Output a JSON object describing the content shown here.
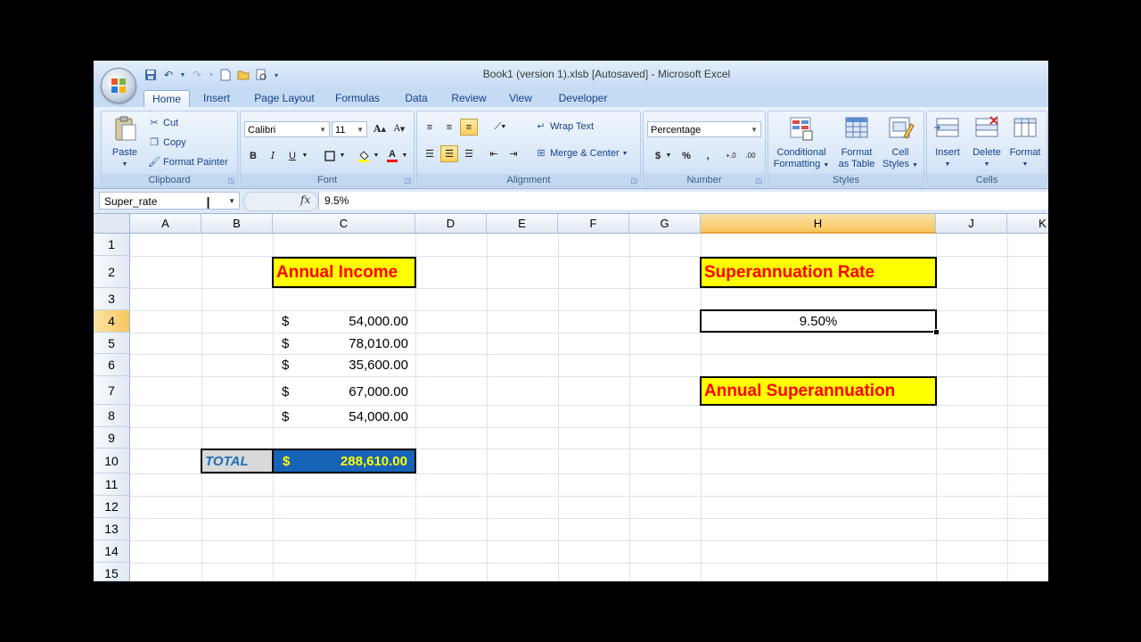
{
  "window": {
    "title": "Book1 (version 1).xlsb [Autosaved] - Microsoft Excel"
  },
  "tabs": [
    "Home",
    "Insert",
    "Page Layout",
    "Formulas",
    "Data",
    "Review",
    "View",
    "Developer"
  ],
  "active_tab": "Home",
  "ribbon": {
    "clipboard": {
      "label": "Clipboard",
      "paste": "Paste",
      "cut": "Cut",
      "copy": "Copy",
      "format_painter": "Format Painter"
    },
    "font": {
      "label": "Font",
      "font_name": "Calibri",
      "font_size": "11",
      "bold": "B",
      "italic": "I",
      "underline": "U"
    },
    "alignment": {
      "label": "Alignment",
      "wrap_text": "Wrap Text",
      "merge_center": "Merge & Center"
    },
    "number": {
      "label": "Number",
      "format": "Percentage",
      "dollar": "$",
      "percent": "%",
      "comma": ","
    },
    "styles": {
      "label": "Styles",
      "conditional": [
        "Conditional",
        "Formatting"
      ],
      "format_table": [
        "Format",
        "as Table"
      ],
      "cell_styles": [
        "Cell",
        "Styles"
      ]
    },
    "cells": {
      "label": "Cells",
      "insert": "Insert",
      "delete": "Delete",
      "format": "Format"
    }
  },
  "formula_bar": {
    "name_box": "Super_rate",
    "fx": "fx",
    "value": "9.5%"
  },
  "columns": [
    "A",
    "B",
    "C",
    "D",
    "E",
    "F",
    "G",
    "H",
    "J",
    "K"
  ],
  "selected_column": "H",
  "rows": [
    "1",
    "2",
    "3",
    "4",
    "5",
    "6",
    "7",
    "8",
    "9",
    "10",
    "11",
    "12",
    "13",
    "14",
    "15"
  ],
  "selected_row": "4",
  "cells": {
    "annual_income_header": "Annual Income",
    "currency_symbol": "$",
    "incomes": [
      "54,000.00",
      "78,010.00",
      "35,600.00",
      "67,000.00",
      "54,000.00"
    ],
    "total_label": "TOTAL",
    "total_value": "288,610.00",
    "super_rate_header": "Superannuation Rate",
    "super_rate_value": "9.50%",
    "annual_super_header": "Annual Superannuation"
  },
  "colors": {
    "header_fill": "#ffff00",
    "header_text": "#ff0000",
    "total_fill": "#1763b8",
    "total_text": "#ffff00",
    "total_label_fill": "#d9d9d9",
    "total_label_text": "#1f6fb5",
    "selection_highlight": "#f8c65d"
  }
}
